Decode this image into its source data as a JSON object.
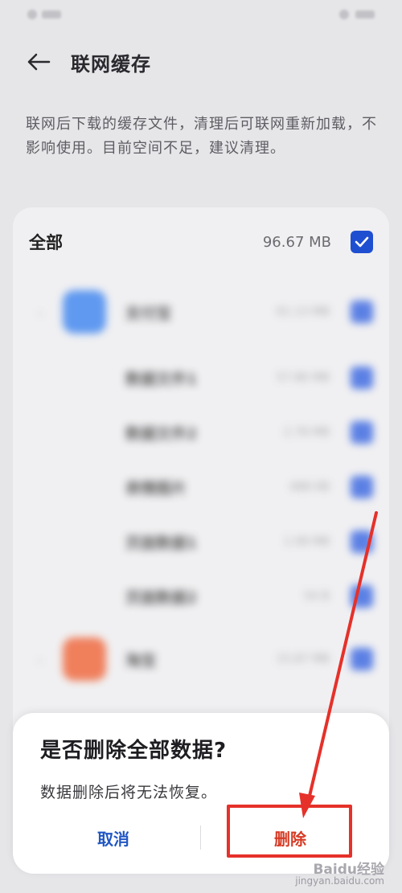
{
  "header": {
    "title": "联网缓存"
  },
  "description": "联网后下载的缓存文件，清理后可联网重新加载，不影响使用。目前空间不足，建议清理。",
  "all_row": {
    "label": "全部",
    "size": "96.67 MB",
    "checked": true
  },
  "blurred_items": [
    {
      "name": "支付宝",
      "size": "61.13 MB",
      "type": "app",
      "color": "#2f7cf0"
    },
    {
      "name": "数据文件1",
      "size": "57.86 MB",
      "type": "sub"
    },
    {
      "name": "数据文件2",
      "size": "2.78 MB",
      "type": "sub"
    },
    {
      "name": "表情图片",
      "size": "488 KB",
      "type": "sub"
    },
    {
      "name": "页面数据1",
      "size": "1.08 MB",
      "type": "sub"
    },
    {
      "name": "页面数据2",
      "size": "54 B",
      "type": "sub"
    },
    {
      "name": "淘宝",
      "size": "15.87 MB",
      "type": "app",
      "color": "#f05a2b"
    }
  ],
  "dialog": {
    "title": "是否删除全部数据?",
    "message": "数据删除后将无法恢复。",
    "cancel_label": "取消",
    "delete_label": "删除"
  },
  "watermark": {
    "main": "Baidu经验",
    "sub": "jingyan.baidu.com"
  },
  "colors": {
    "accent": "#1f4fd1",
    "danger": "#d63a24",
    "annotation": "#e5312a"
  }
}
